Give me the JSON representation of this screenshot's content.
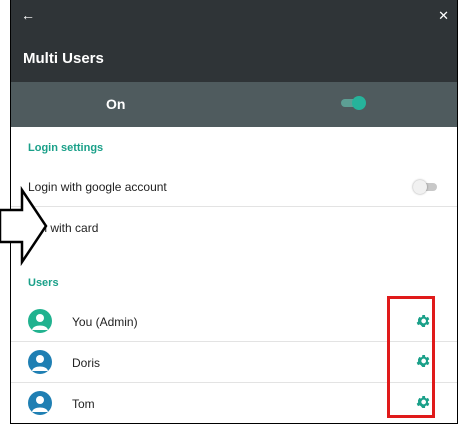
{
  "window": {
    "back_icon": "arrow-left-icon",
    "close_icon": "close-icon",
    "title": "Multi Users"
  },
  "master_toggle": {
    "label": "On",
    "state": true
  },
  "login_settings": {
    "header": "Login settings",
    "google": {
      "label": "Login with google account",
      "state": false
    },
    "card": {
      "label": "gin with card",
      "sublabel": "f"
    }
  },
  "users": {
    "header": "Users",
    "list": [
      {
        "name": "You (Admin)",
        "avatar_color": "#21b28f",
        "settings_icon": "gear-icon"
      },
      {
        "name": "Doris",
        "avatar_color": "#1f7fb3",
        "settings_icon": "gear-icon"
      },
      {
        "name": "Tom",
        "avatar_color": "#1f7fb3",
        "settings_icon": "gear-icon"
      }
    ]
  },
  "colors": {
    "accent": "#1aa089",
    "header_bg": "#2f3437",
    "toggle_bar_bg": "#4f5b5e",
    "highlight": "#e01a1a"
  }
}
